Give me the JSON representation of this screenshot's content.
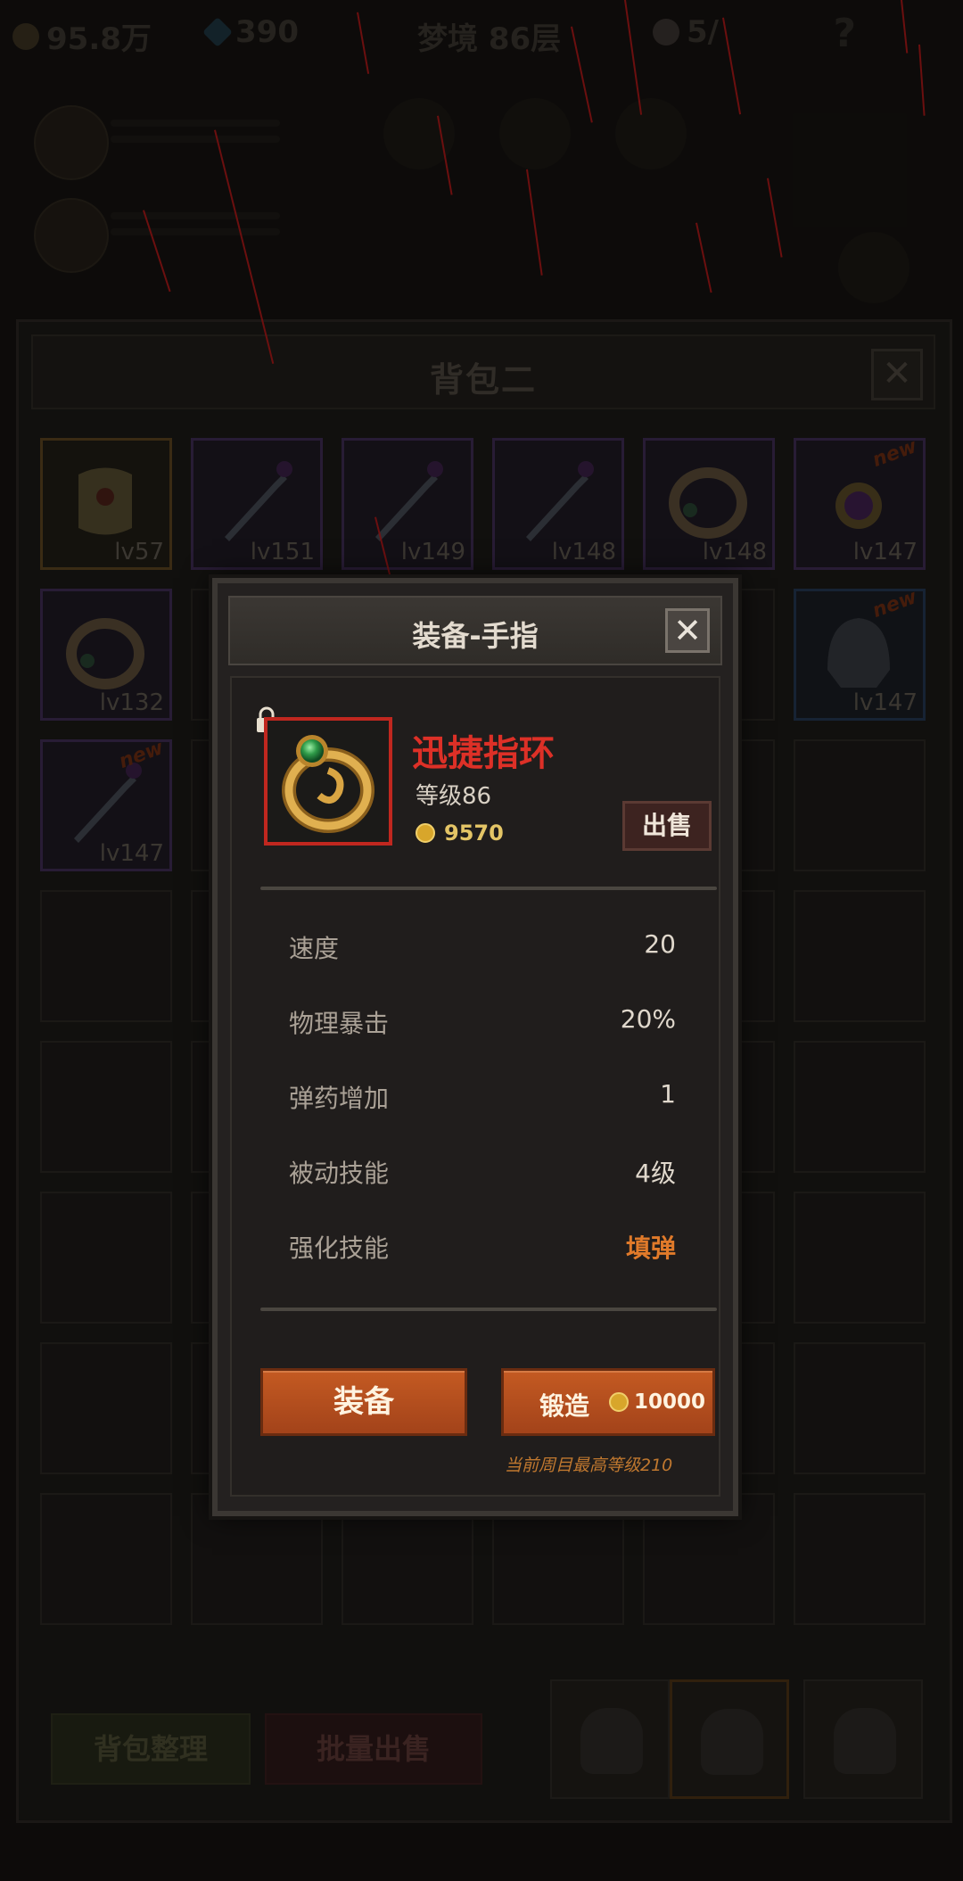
{
  "hud": {
    "gold": "95.8万",
    "gems": "390",
    "dream_level": "梦境 86层",
    "skull_count": "5/",
    "help": "?"
  },
  "bag": {
    "title": "背包二",
    "close": "✕",
    "items": [
      {
        "level": "lv57",
        "rarity": "gold",
        "kind": "armor",
        "new": false
      },
      {
        "level": "lv151",
        "rarity": "purple",
        "kind": "sword",
        "new": false
      },
      {
        "level": "lv149",
        "rarity": "purple",
        "kind": "sword",
        "new": false
      },
      {
        "level": "lv148",
        "rarity": "purple",
        "kind": "sword",
        "new": false
      },
      {
        "level": "lv148",
        "rarity": "purple",
        "kind": "ring",
        "new": false
      },
      {
        "level": "lv147",
        "rarity": "purple",
        "kind": "amulet",
        "new": true
      },
      {
        "level": "lv132",
        "rarity": "purple",
        "kind": "ring",
        "new": false
      },
      {
        "level": "lv147",
        "rarity": "blue",
        "kind": "helmet",
        "new": true
      },
      {
        "level": "lv147",
        "rarity": "purple",
        "kind": "sword",
        "new": true
      }
    ],
    "new_badge": "new",
    "sort_button": "背包整理",
    "bulk_sell_button": "批量出售"
  },
  "modal": {
    "title": "装备-手指",
    "close": "✕",
    "item": {
      "name": "迅捷指环",
      "level": "等级86",
      "price": "9570"
    },
    "sell_button": "出售",
    "stats": [
      {
        "label": "速度",
        "value": "20"
      },
      {
        "label": "物理暴击",
        "value": "20%"
      },
      {
        "label": "弹药增加",
        "value": "1"
      },
      {
        "label": "被动技能",
        "value": "4级"
      },
      {
        "label": "强化技能",
        "value": "填弹",
        "highlight": true
      }
    ],
    "equip_button": "装备",
    "forge_button": "锻造",
    "forge_cost": "10000",
    "forge_note": "当前周目最高等级210"
  },
  "colors": {
    "title_red": "#dd3027",
    "accent_orange": "#e07a2a",
    "button_orange": "#c45a22",
    "gold": "#e4c566"
  }
}
